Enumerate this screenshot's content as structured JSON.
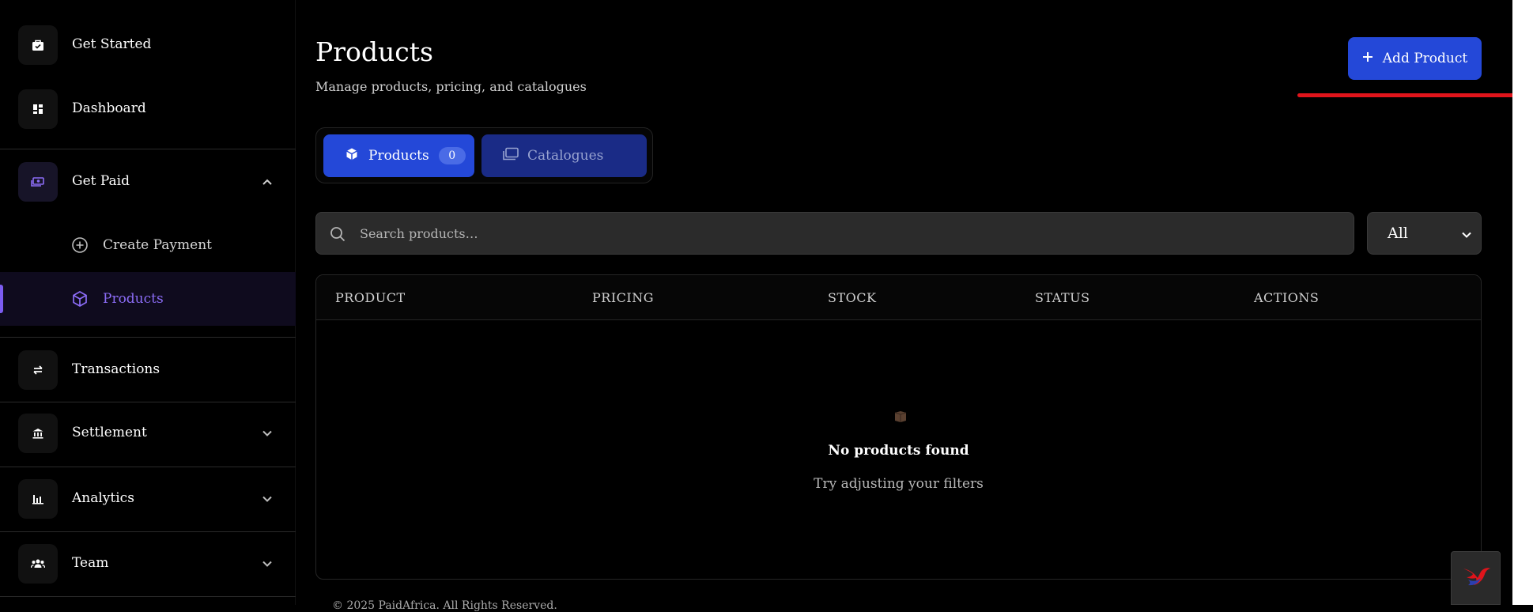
{
  "sidebar": {
    "items": [
      {
        "label": "Get Started",
        "icon": "briefcase-check-icon"
      },
      {
        "label": "Dashboard",
        "icon": "dashboard-icon"
      },
      {
        "label": "Get Paid",
        "icon": "payment-icon",
        "expanded": true
      },
      {
        "label": "Transactions",
        "icon": "arrows-exchange-icon"
      },
      {
        "label": "Settlement",
        "icon": "bank-icon"
      },
      {
        "label": "Analytics",
        "icon": "bar-chart-icon"
      },
      {
        "label": "Team",
        "icon": "team-icon"
      }
    ],
    "sub_items": [
      {
        "label": "Create Payment",
        "icon": "plus-circle-icon"
      },
      {
        "label": "Products",
        "icon": "cube-icon",
        "active": true
      }
    ],
    "accent_color": "#7c5cf0"
  },
  "header": {
    "title": "Products",
    "subtitle": "Manage products, pricing, and catalogues",
    "add_button_label": "Add Product",
    "add_button_color": "#2448d8"
  },
  "tabs": {
    "products_label": "Products",
    "products_count": "0",
    "catalogues_label": "Catalogues"
  },
  "search": {
    "placeholder": "Search products…",
    "value": ""
  },
  "filter": {
    "selected": "All"
  },
  "table": {
    "columns": [
      "PRODUCT",
      "PRICING",
      "STOCK",
      "STATUS",
      "ACTIONS"
    ],
    "empty_title": "No products found",
    "empty_subtitle": "Try adjusting your filters"
  },
  "footer": {
    "text": "© 2025 PaidAfrica. All Rights Reserved."
  }
}
